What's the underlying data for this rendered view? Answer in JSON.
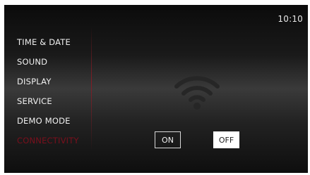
{
  "status_bar": {
    "clock": "10:10"
  },
  "menu": {
    "items": [
      {
        "label": "TIME & DATE",
        "active": false
      },
      {
        "label": "SOUND",
        "active": false
      },
      {
        "label": "DISPLAY",
        "active": false
      },
      {
        "label": "SERVICE",
        "active": false
      },
      {
        "label": "DEMO MODE",
        "active": false
      },
      {
        "label": "CONNECTIVITY",
        "active": true
      }
    ]
  },
  "connectivity": {
    "icon": "wifi-icon",
    "on_label": "ON",
    "off_label": "OFF",
    "selected": "OFF"
  },
  "colors": {
    "active_menu": "#7a0f1c",
    "text": "#f0f0f0",
    "selected_toggle_bg": "#ffffff"
  }
}
